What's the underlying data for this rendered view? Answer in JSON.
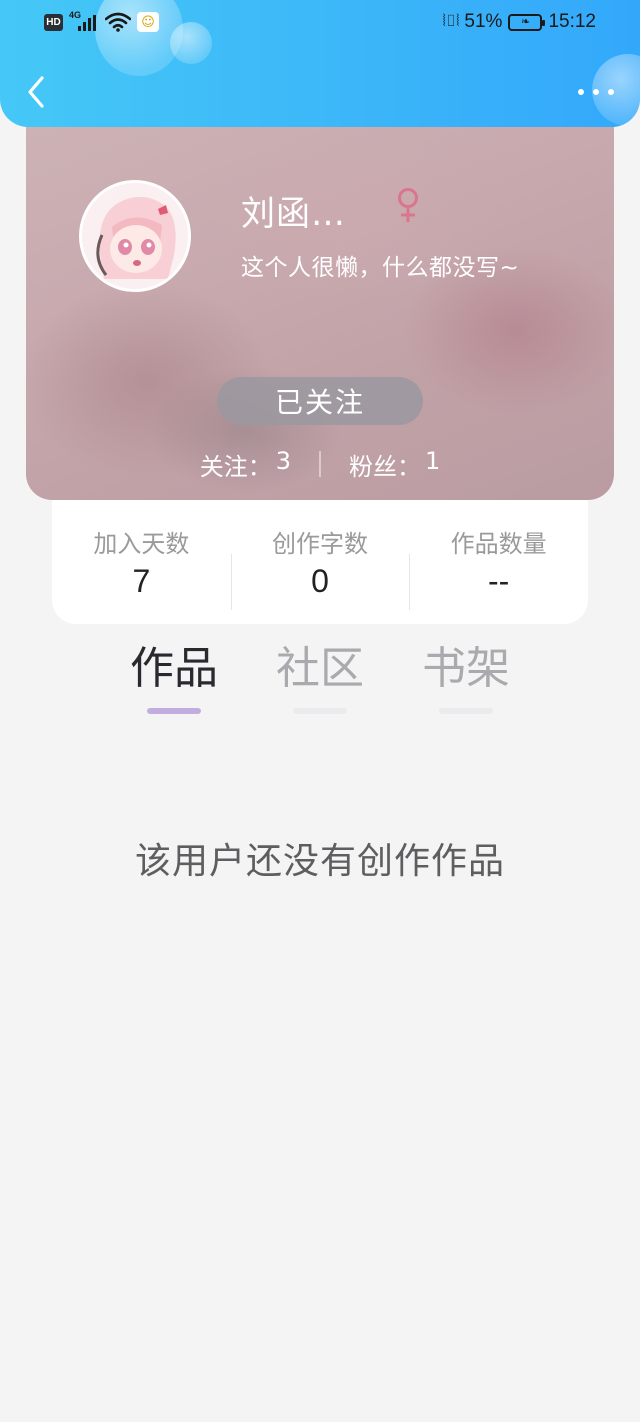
{
  "status_bar": {
    "hd_badge": "HD",
    "network_type": "4G",
    "battery_percent": "51%",
    "time": "15:12",
    "icons": [
      "hd-icon",
      "signal-4g-icon",
      "wifi-icon",
      "app-notification-icon",
      "vibrate-icon",
      "battery-icon"
    ]
  },
  "nav": {
    "back_icon": "chevron-left-icon",
    "more_icon": "more-dots-icon"
  },
  "profile": {
    "nickname": "刘函…",
    "gender_icon": "female-icon",
    "gender_color": "#d9768e",
    "bio": "这个人很懒，什么都没写~",
    "follow_button_label": "已关注",
    "following_label": "关注：",
    "following_count": "3",
    "fans_label": "粉丝：",
    "fans_count": "1"
  },
  "stats": [
    {
      "label": "加入天数",
      "value": "7"
    },
    {
      "label": "创作字数",
      "value": "0"
    },
    {
      "label": "作品数量",
      "value": "--"
    }
  ],
  "tabs": [
    {
      "label": "作品",
      "active": true
    },
    {
      "label": "社区",
      "active": false
    },
    {
      "label": "书架",
      "active": false
    }
  ],
  "empty_message": "该用户还没有创作作品",
  "colors": {
    "header_gradient_start": "#45c8f7",
    "header_gradient_end": "#33a8fb",
    "active_tab_indicator": "#c1aedf",
    "page_background": "#f4f4f4"
  }
}
